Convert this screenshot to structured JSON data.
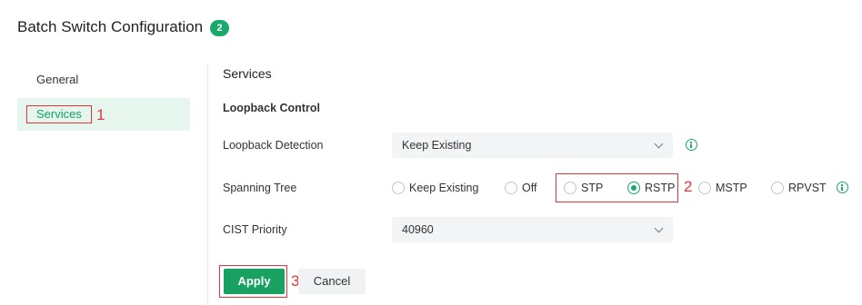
{
  "header": {
    "title": "Batch Switch Configuration",
    "badge_count": "2"
  },
  "sidebar": {
    "items": [
      {
        "label": "General",
        "active": false
      },
      {
        "label": "Services",
        "active": true
      }
    ]
  },
  "annotations": {
    "step1": "1",
    "step2": "2",
    "step3": "3"
  },
  "main": {
    "section_title": "Services",
    "subsection_title": "Loopback Control",
    "loopback_detection": {
      "label": "Loopback Detection",
      "value": "Keep Existing"
    },
    "spanning_tree": {
      "label": "Spanning Tree",
      "options": [
        "Keep Existing",
        "Off",
        "STP",
        "RSTP",
        "MSTP",
        "RPVST"
      ],
      "selected": "RSTP"
    },
    "cist_priority": {
      "label": "CIST Priority",
      "value": "40960"
    }
  },
  "actions": {
    "apply_label": "Apply",
    "cancel_label": "Cancel"
  },
  "colors": {
    "accent": "#1aa96b",
    "callout": "#e0363b",
    "active_bg": "#e6f6ee"
  },
  "icons": [
    "info-icon",
    "chevron-down-icon",
    "radio-icon"
  ]
}
